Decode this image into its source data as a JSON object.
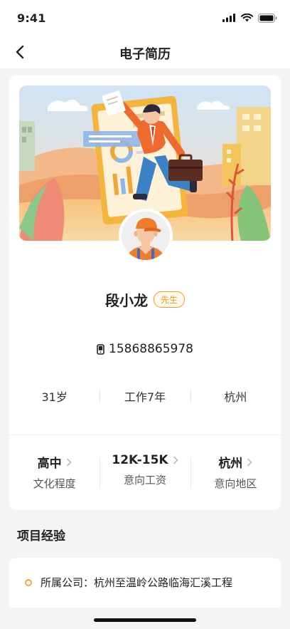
{
  "status": {
    "time": "9:41"
  },
  "nav": {
    "title": "电子简历"
  },
  "profile": {
    "name": "段小龙",
    "title_badge": "先生",
    "phone": "15868865978",
    "info": [
      "31岁",
      "工作7年",
      "杭州"
    ]
  },
  "stats": [
    {
      "value": "高中",
      "label": "文化程度"
    },
    {
      "value": "12K-15K",
      "label": "意向工资"
    },
    {
      "value": "杭州",
      "label": "意向地区"
    }
  ],
  "projects": {
    "section_title": "项目经验",
    "items": [
      {
        "label": "所属公司：杭州至温岭公路临海汇溪工程"
      }
    ]
  },
  "colors": {
    "accent": "#f39a1d",
    "background": "#f4f4f6"
  }
}
